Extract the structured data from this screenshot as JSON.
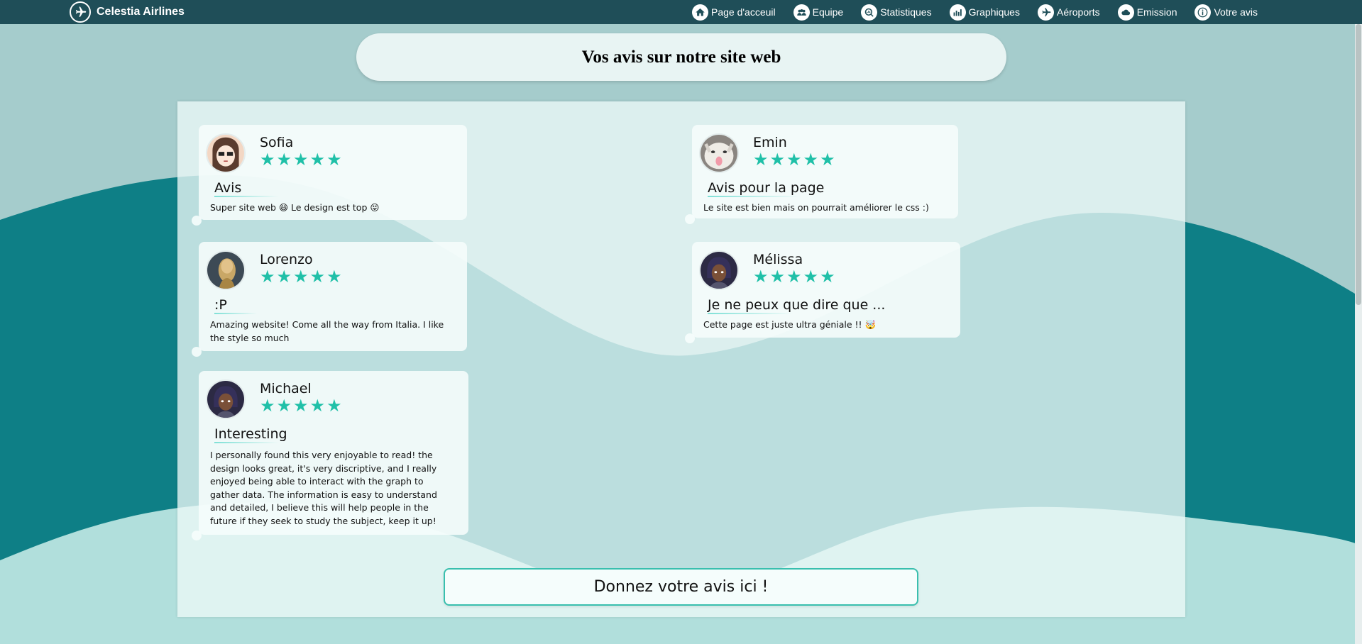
{
  "brand": {
    "name": "Celestia Airlines",
    "icon": "plane-icon"
  },
  "nav": [
    {
      "label": "Page d'acceuil",
      "icon": "home-icon"
    },
    {
      "label": "Equipe",
      "icon": "team-icon"
    },
    {
      "label": "Statistiques",
      "icon": "stats-icon"
    },
    {
      "label": "Graphiques",
      "icon": "graph-icon"
    },
    {
      "label": "Aéroports",
      "icon": "plane-icon"
    },
    {
      "label": "Emission",
      "icon": "cloud-icon"
    },
    {
      "label": "Votre avis",
      "icon": "info-icon"
    }
  ],
  "page_title": "Vos avis sur notre site web",
  "reviews": [
    {
      "name": "Sofia",
      "rating": 5,
      "title": "Avis",
      "text": "Super site web 😄 Le design est top 😝"
    },
    {
      "name": "Emin",
      "rating": 5,
      "title": "Avis pour la page",
      "text": "Le site est bien mais on pourrait améliorer le css :)"
    },
    {
      "name": "Lorenzo",
      "rating": 5,
      "title": ":P",
      "text": "Amazing website! Come all the way from Italia. I like the style so much"
    },
    {
      "name": "Mélissa",
      "rating": 5,
      "title": "Je ne peux que dire que ...",
      "text": "Cette page est juste ultra géniale !! 🤯"
    },
    {
      "name": "Michael",
      "rating": 5,
      "title": "Interesting",
      "text": "I personally found this very enjoyable to read! the design looks great, it's very discriptive, and I really enjoyed being able to interact with the graph to gather data. The information is easy to understand and detailed, I believe this will help people in the future if they seek to study the subject, keep it up!"
    }
  ],
  "cta_label": "Donnez votre avis ici !",
  "colors": {
    "navbar": "#1f4e58",
    "accent": "#20c0a8",
    "wave": "#0e7f86",
    "background": "#a5cccc"
  }
}
